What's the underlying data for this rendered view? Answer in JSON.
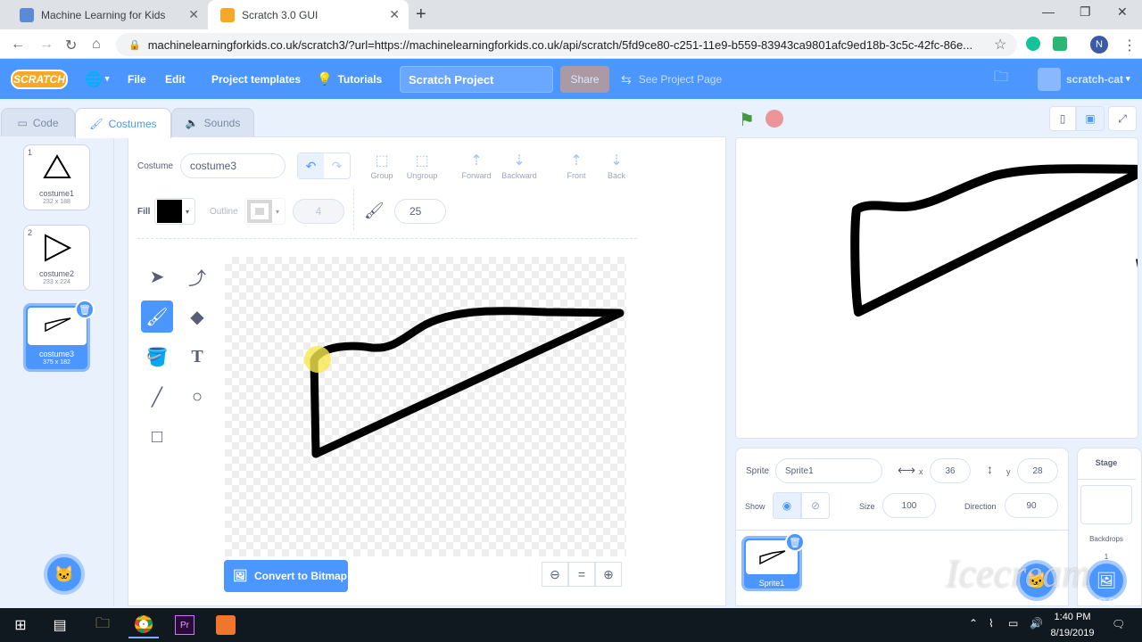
{
  "browser": {
    "tabs": [
      {
        "title": "Machine Learning for Kids"
      },
      {
        "title": "Scratch 3.0 GUI"
      }
    ],
    "url": "machinelearningforkids.co.uk/scratch3/?url=https://machinelearningforkids.co.uk/api/scratch/5fd9ce80-c251-11e9-b559-83943ca9801afc9ed18b-3c5c-42fc-86e...",
    "profile_initial": "N"
  },
  "menubar": {
    "logo": "SCRATCH",
    "file": "File",
    "edit": "Edit",
    "templates": "Project templates",
    "tutorials": "Tutorials",
    "project_title": "Scratch Project",
    "share": "Share",
    "see_project": "See Project Page",
    "username": "scratch-cat"
  },
  "editor_tabs": {
    "code": "Code",
    "costumes": "Costumes",
    "sounds": "Sounds"
  },
  "costumes": [
    {
      "num": "1",
      "name": "costume1",
      "size": "232 x 188"
    },
    {
      "num": "2",
      "name": "costume2",
      "size": "233 x 224"
    },
    {
      "num": "3",
      "name": "costume3",
      "size": "375 x 182"
    }
  ],
  "paint": {
    "costume_label": "Costume",
    "costume_name": "costume3",
    "group": "Group",
    "ungroup": "Ungroup",
    "forward": "Forward",
    "backward": "Backward",
    "front": "Front",
    "back": "Back",
    "fill_label": "Fill",
    "outline_label": "Outline",
    "outline_width": "4",
    "brush_size": "25",
    "fill_color": "#000000",
    "outline_color": "#bfbfbf",
    "convert": "Convert to Bitmap",
    "zoom_reset": "="
  },
  "sprite": {
    "label": "Sprite",
    "name": "Sprite1",
    "x_label": "x",
    "x": "36",
    "y_label": "y",
    "y": "28",
    "show_label": "Show",
    "size_label": "Size",
    "size": "100",
    "direction_label": "Direction",
    "direction": "90",
    "thumb_name": "Sprite1"
  },
  "stage_panel": {
    "title": "Stage",
    "backdrops": "Backdrops",
    "count": "1"
  },
  "taskbar": {
    "time": "1:40 PM",
    "date": "8/19/2019"
  },
  "watermark": "Icecream Apps",
  "colors": {
    "accent": "#4c97ff",
    "menubar": "#4c97ff",
    "flag": "#45993d",
    "stop": "#ec5959"
  }
}
